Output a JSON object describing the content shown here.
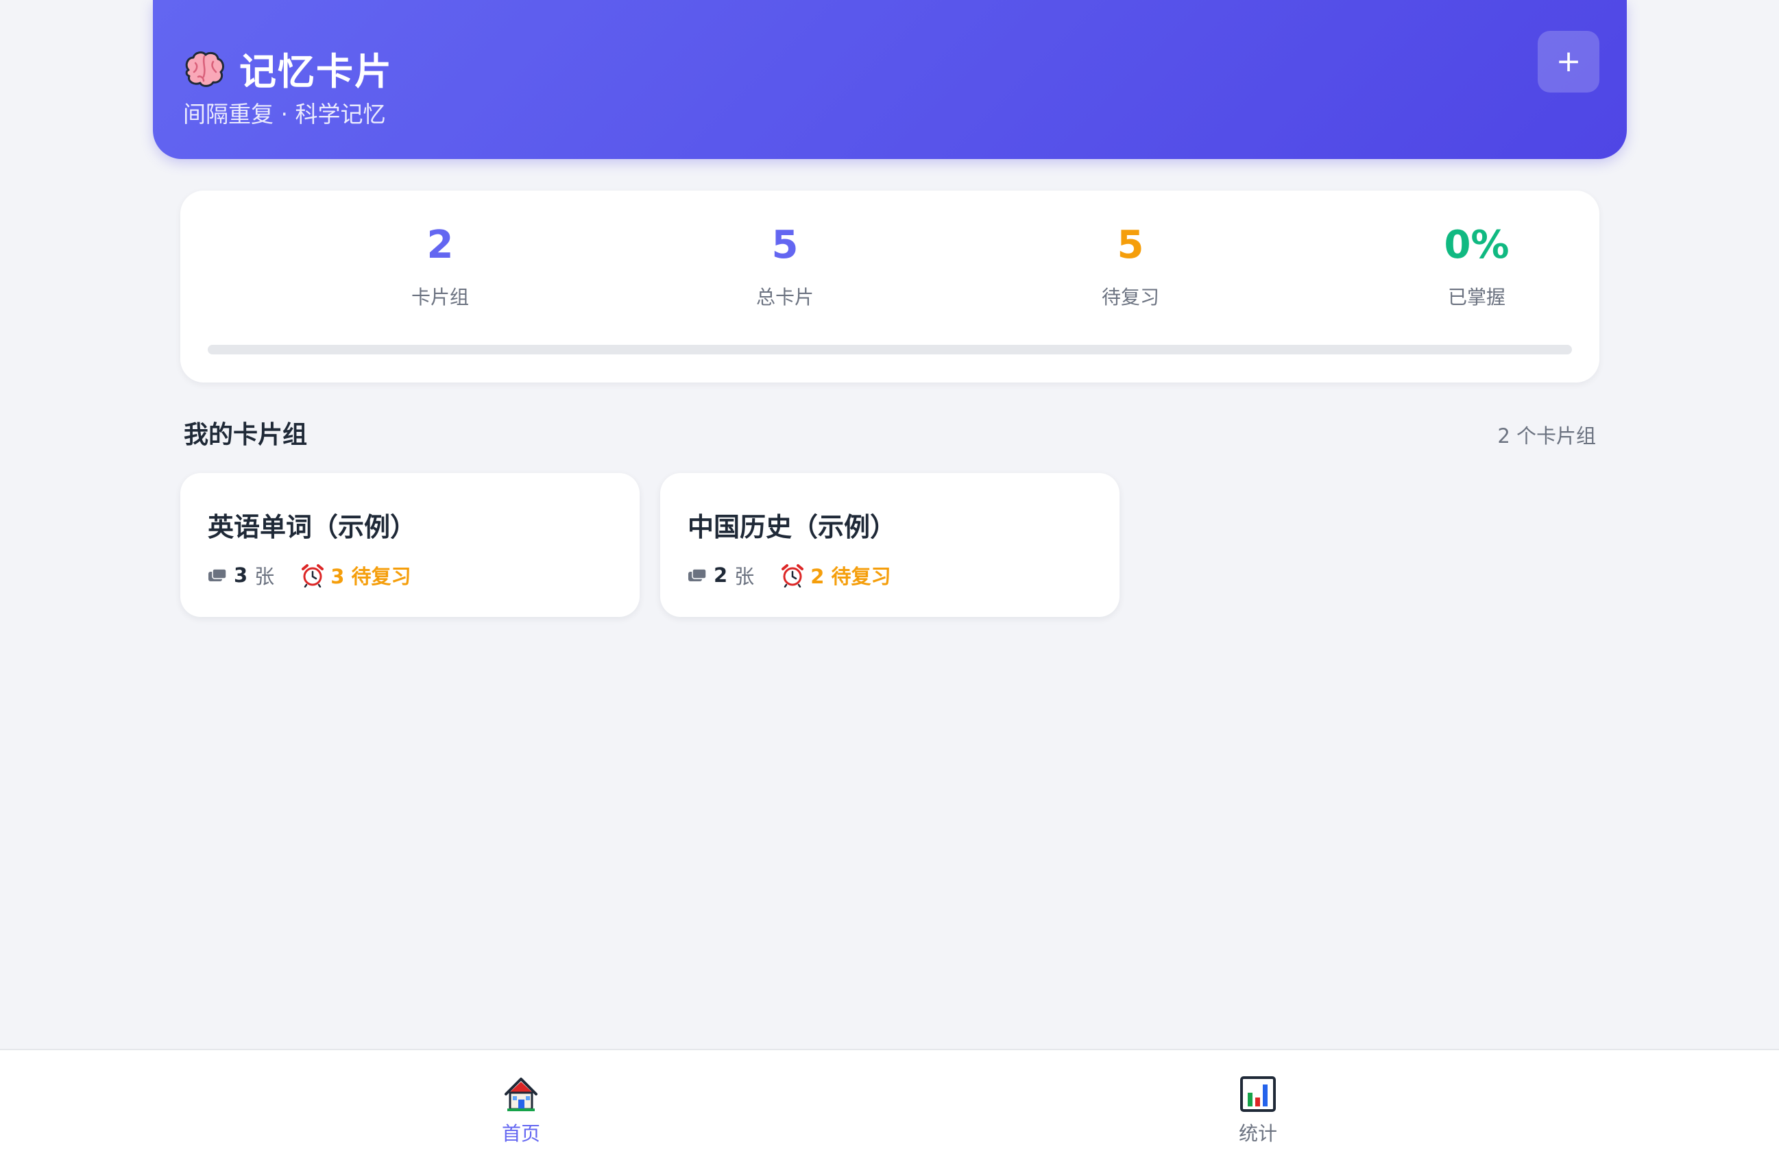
{
  "header": {
    "title": "记忆卡片",
    "subtitle": "间隔重复 · 科学记忆",
    "add_label": "+",
    "brand_icon": "brain-icon",
    "gradient": [
      "#6366f1",
      "#4f46e5"
    ]
  },
  "stats": [
    {
      "value": "2",
      "label": "卡片组",
      "color": "#6366f1"
    },
    {
      "value": "5",
      "label": "总卡片",
      "color": "#6366f1"
    },
    {
      "value": "5",
      "label": "待复习",
      "color": "#f59e0b"
    },
    {
      "value": "0%",
      "label": "已掌握",
      "color": "#10b981"
    }
  ],
  "mastery_progress": 0,
  "section": {
    "title": "我的卡片组",
    "count": "2 个卡片组"
  },
  "decks": [
    {
      "title": "英语单词（示例）",
      "cards": "3",
      "unit": "张",
      "due": "3 待复习"
    },
    {
      "title": "中国历史（示例）",
      "cards": "2",
      "unit": "张",
      "due": "2 待复习"
    }
  ],
  "nav": [
    {
      "label": "首页",
      "icon": "home-icon",
      "active": true,
      "color": "#6366f1"
    },
    {
      "label": "统计",
      "icon": "bar-chart-icon",
      "active": false,
      "color": "#6b7280"
    }
  ]
}
